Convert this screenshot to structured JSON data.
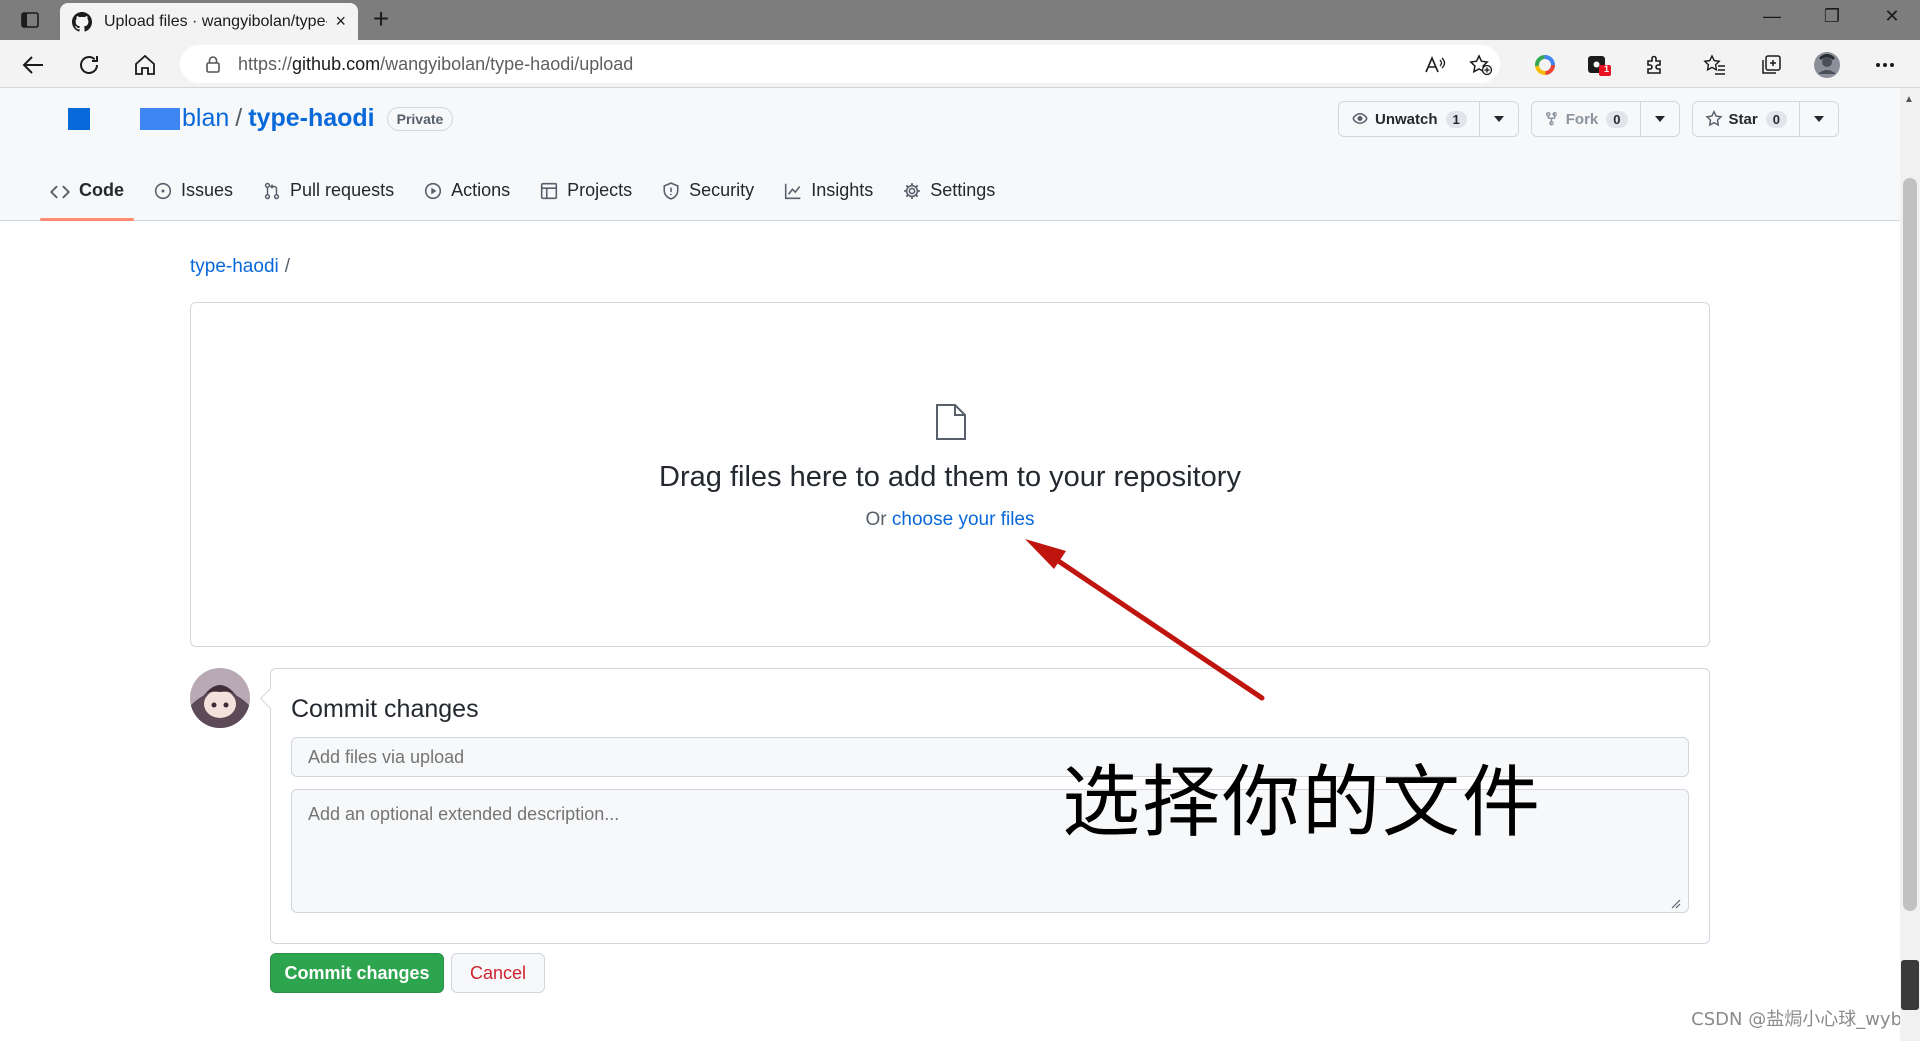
{
  "browser": {
    "tab_title": "Upload files · wangyibolan/type-",
    "tab_close": "×",
    "new_tab": "+",
    "url_prefix": "https://",
    "url_host": "github.com",
    "url_path": "/wangyibolan/type-haodi/upload",
    "window_minimize": "—",
    "window_restore": "❐",
    "window_close": "✕",
    "extension_badge": "1"
  },
  "repo": {
    "owner_visible": "blan",
    "separator": "/",
    "name": "type-haodi",
    "visibility": "Private",
    "watch_label": "Unwatch",
    "watch_count": "1",
    "fork_label": "Fork",
    "fork_count": "0",
    "star_label": "Star",
    "star_count": "0"
  },
  "nav": {
    "code": "Code",
    "issues": "Issues",
    "pull_requests": "Pull requests",
    "actions": "Actions",
    "projects": "Projects",
    "security": "Security",
    "insights": "Insights",
    "settings": "Settings"
  },
  "breadcrumb": {
    "repo": "type-haodi",
    "slash": "/"
  },
  "dropzone": {
    "title": "Drag files here to add them to your repository",
    "or_text": "Or ",
    "choose_link": "choose your files"
  },
  "commit": {
    "title": "Commit changes",
    "summary_placeholder": "Add files via upload",
    "description_placeholder": "Add an optional extended description...",
    "commit_button": "Commit changes",
    "cancel_button": "Cancel"
  },
  "annotation": {
    "text": "选择你的文件",
    "arrow_color": "#c0150f"
  },
  "watermark": "CSDN @盐焗小心球_wyb",
  "colors": {
    "link": "#0969da",
    "primary_button": "#2da44e",
    "danger_text": "#cf222e",
    "selected_tab_underline": "#fd8c73"
  }
}
